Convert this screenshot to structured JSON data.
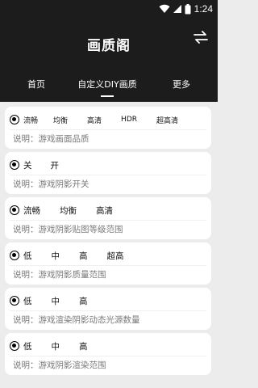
{
  "status_bar": {
    "time": "1:24",
    "icons": [
      "wifi-icon",
      "signal-icon",
      "battery-icon"
    ]
  },
  "header": {
    "title": "画质阁",
    "action_icon": "swap-arrows-icon"
  },
  "tabs": [
    {
      "label": "首页",
      "selected": false
    },
    {
      "label": "自定义DIY画质",
      "selected": true
    },
    {
      "label": "更多",
      "selected": false
    }
  ],
  "colors": {
    "header_bg": "#1c1c1c",
    "page_bg": "#ececec",
    "card_bg": "#ffffff",
    "description_text": "#7a7a7a"
  },
  "settings": [
    {
      "options": [
        "流畅",
        "均衡",
        "高清",
        "HDR",
        "超高清"
      ],
      "description": "说明：游戏画面品质"
    },
    {
      "options": [
        "关",
        "开"
      ],
      "description": "说明：游戏阴影开关"
    },
    {
      "options": [
        "流畅",
        "均衡",
        "高清"
      ],
      "description": "说明：游戏阴影贴图等级范围"
    },
    {
      "options": [
        "低",
        "中",
        "高",
        "超高"
      ],
      "description": "说明：游戏阴影质量范围"
    },
    {
      "options": [
        "低",
        "中",
        "高"
      ],
      "description": "说明：游戏渲染阴影动态光源数量"
    },
    {
      "options": [
        "低",
        "中",
        "高"
      ],
      "description": "说明：游戏阴影渲染范围"
    }
  ]
}
